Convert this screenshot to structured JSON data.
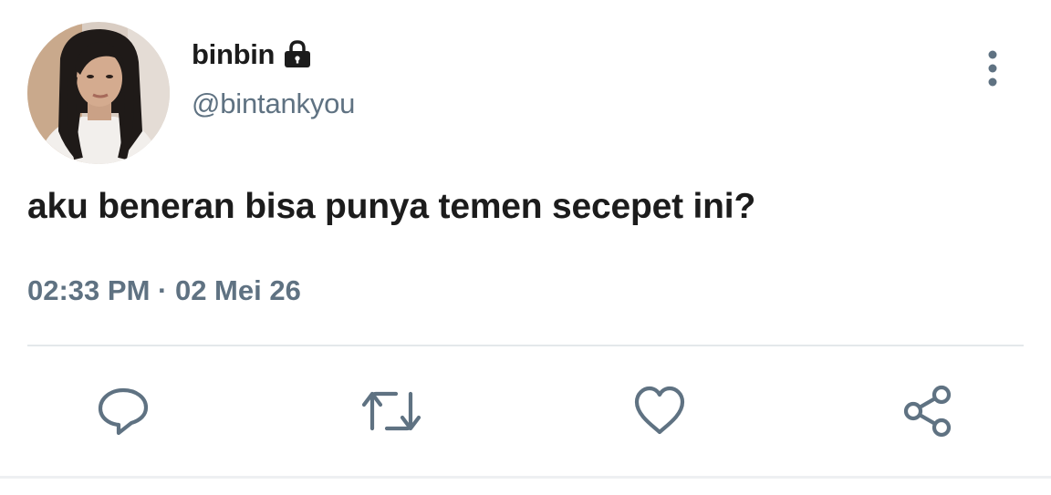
{
  "tweet": {
    "display_name": "binbin",
    "handle": "@bintankyou",
    "text": "aku beneran bisa punya temen secepet ini?",
    "timestamp": "02:33 PM · 02 Mei 26",
    "protected_icon": "lock-icon"
  },
  "actions": [
    {
      "name": "reply",
      "icon": "speech-bubble-icon"
    },
    {
      "name": "retweet",
      "icon": "retweet-arrows-icon"
    },
    {
      "name": "like",
      "icon": "heart-outline-icon"
    },
    {
      "name": "share",
      "icon": "share-nodes-icon"
    }
  ],
  "menu": {
    "icon": "vertical-ellipsis-icon"
  },
  "colors": {
    "text_primary": "#1c1c1c",
    "text_secondary": "#5f7282",
    "icon": "#5f7282",
    "divider": "#e4e8eb",
    "background": "#ffffff"
  }
}
